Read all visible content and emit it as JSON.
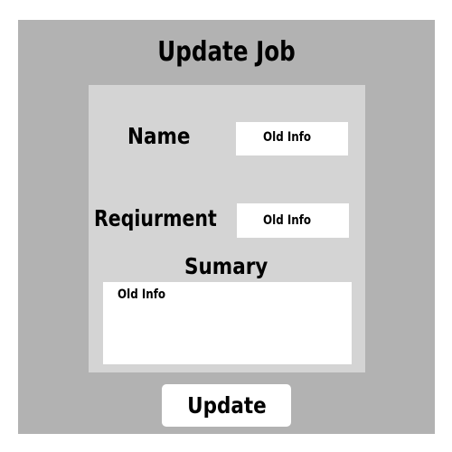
{
  "title": "Update Job",
  "form": {
    "name": {
      "label": "Name",
      "value": "Old Info"
    },
    "requirement": {
      "label": "Reqiurment",
      "value": "Old Info"
    },
    "summary": {
      "label": "Sumary",
      "value": "Old Info"
    }
  },
  "update_button_label": "Update",
  "colors": {
    "frame_background": "#b2b2b2",
    "panel_background": "#d4d4d4",
    "field_background": "#ffffff"
  }
}
